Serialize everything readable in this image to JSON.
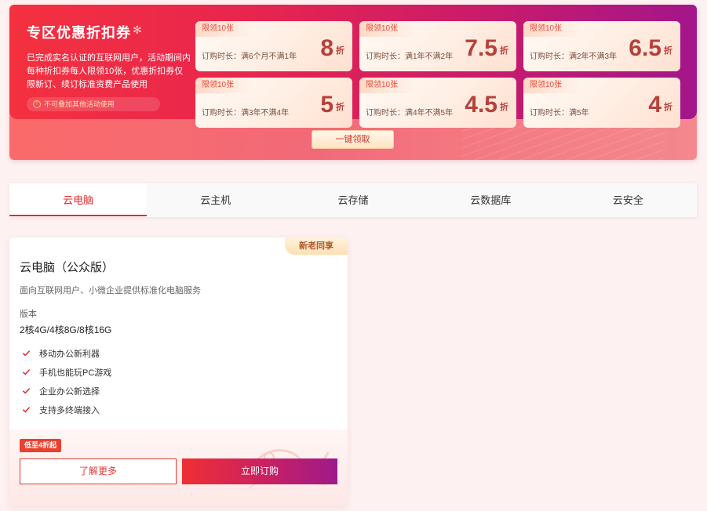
{
  "promo": {
    "title": "专区优惠折扣券",
    "flower_icon": "flower-icon",
    "description": "已完成实名认证的互联网用户，活动期间内每种折扣券每人限领10张，优惠折扣券仅限新订、续订标准资费产品使用",
    "note": "不可叠加其他活动使用",
    "note_icon": "info-icon",
    "claim_label": "一键领取",
    "coupons": [
      {
        "limit": "限领10张",
        "term": "订购时长：满6个月不满1年",
        "discount": "8",
        "unit": "折"
      },
      {
        "limit": "限领10张",
        "term": "订购时长：满1年不满2年",
        "discount": "7.5",
        "unit": "折"
      },
      {
        "limit": "限领10张",
        "term": "订购时长：满2年不满3年",
        "discount": "6.5",
        "unit": "折"
      },
      {
        "limit": "限领10张",
        "term": "订购时长：满3年不满4年",
        "discount": "5",
        "unit": "折"
      },
      {
        "limit": "限领10张",
        "term": "订购时长：满4年不满5年",
        "discount": "4.5",
        "unit": "折"
      },
      {
        "limit": "限领10张",
        "term": "订购时长：满5年",
        "discount": "4",
        "unit": "折"
      }
    ]
  },
  "tabs": [
    {
      "label": "云电脑",
      "active": true
    },
    {
      "label": "云主机",
      "active": false
    },
    {
      "label": "云存储",
      "active": false
    },
    {
      "label": "云数据库",
      "active": false
    },
    {
      "label": "云安全",
      "active": false
    }
  ],
  "product": {
    "badge": "新老同享",
    "title": "云电脑（公众版）",
    "description": "面向互联网用户、小微企业提供标准化电脑服务",
    "version_label": "版本",
    "version_value": "2核4G/4核8G/8核16G",
    "features": [
      "移动办公新利器",
      "手机也能玩PC游戏",
      "企业办公新选择",
      "支持多终端接入"
    ],
    "check_icon": "check-icon",
    "low_tag": "低至4折起",
    "more_label": "了解更多",
    "buy_label": "立即订购"
  },
  "colors": {
    "accent": "#e12b2f",
    "gradient_start": "#f4313f",
    "gradient_end": "#a3168a",
    "page_bg": "#fdf1f1"
  }
}
